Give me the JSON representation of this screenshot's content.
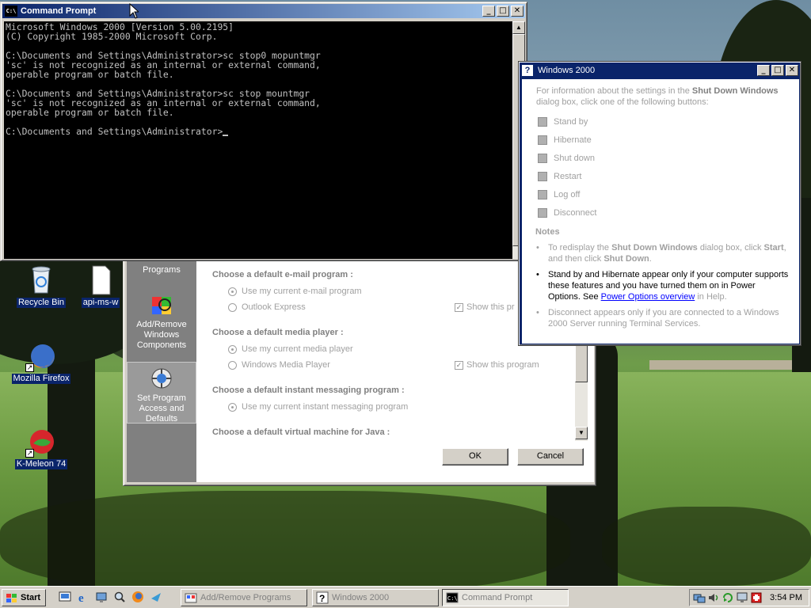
{
  "desktop": {
    "icons": [
      {
        "label": "Recycle Bin"
      },
      {
        "label": "api-ms-w"
      },
      {
        "label": "Mozilla Firefox"
      },
      {
        "label": "K-Meleon 74"
      }
    ]
  },
  "cmd": {
    "title": "Command Prompt",
    "lines": [
      "Microsoft Windows 2000 [Version 5.00.2195]",
      "(C) Copyright 1985-2000 Microsoft Corp.",
      "",
      "C:\\Documents and Settings\\Administrator>sc stop0 mopuntmgr",
      "'sc' is not recognized as an internal or external command,",
      "operable program or batch file.",
      "",
      "C:\\Documents and Settings\\Administrator>sc stop mountmgr",
      "'sc' is not recognized as an internal or external command,",
      "operable program or batch file.",
      "",
      "C:\\Documents and Settings\\Administrator>"
    ]
  },
  "arp": {
    "sidebar": {
      "programs_label": "Programs",
      "addremove_label": "Add/Remove Windows Components",
      "setprogram_label": "Set Program Access and Defaults"
    },
    "sections": {
      "email": "Choose a default e-mail program :",
      "email_opt1": "Use my current e-mail program",
      "email_opt2": "Outlook Express",
      "email_show": "Show this pr",
      "media": "Choose a default media player :",
      "media_opt1": "Use my current media player",
      "media_opt2": "Windows Media Player",
      "media_show": "Show this program",
      "im": "Choose a default instant messaging program :",
      "im_opt1": "Use my current instant messaging program",
      "java": "Choose a default virtual machine for Java :"
    },
    "ok_label": "OK",
    "cancel_label": "Cancel"
  },
  "help": {
    "title": "Windows 2000",
    "intro_pre": "For information about the settings in the ",
    "intro_bold": "Shut Down Windows",
    "intro_post": " dialog box, click one of the following buttons:",
    "buttons": [
      "Stand by",
      "Hibernate",
      "Shut down",
      "Restart",
      "Log off",
      "Disconnect"
    ],
    "notes_heading": "Notes",
    "note1_a": "To redisplay the ",
    "note1_b": "Shut Down Windows",
    "note1_c": " dialog box, click ",
    "note1_d": "Start",
    "note1_e": ", and then click ",
    "note1_f": "Shut Down",
    "note1_g": ".",
    "note2_a": "Stand by and Hibernate appear only if your computer supports these features and you have turned them on in Power Options. See ",
    "note2_link": "Power Options overview",
    "note2_b": " in Help.",
    "note3": "Disconnect appears only if you are connected to a Windows 2000 Server running Terminal Services."
  },
  "taskbar": {
    "start_label": "Start",
    "tasks": [
      {
        "label": "Add/Remove Programs"
      },
      {
        "label": "Windows 2000"
      },
      {
        "label": "Command Prompt"
      }
    ],
    "clock": "3:54 PM"
  }
}
